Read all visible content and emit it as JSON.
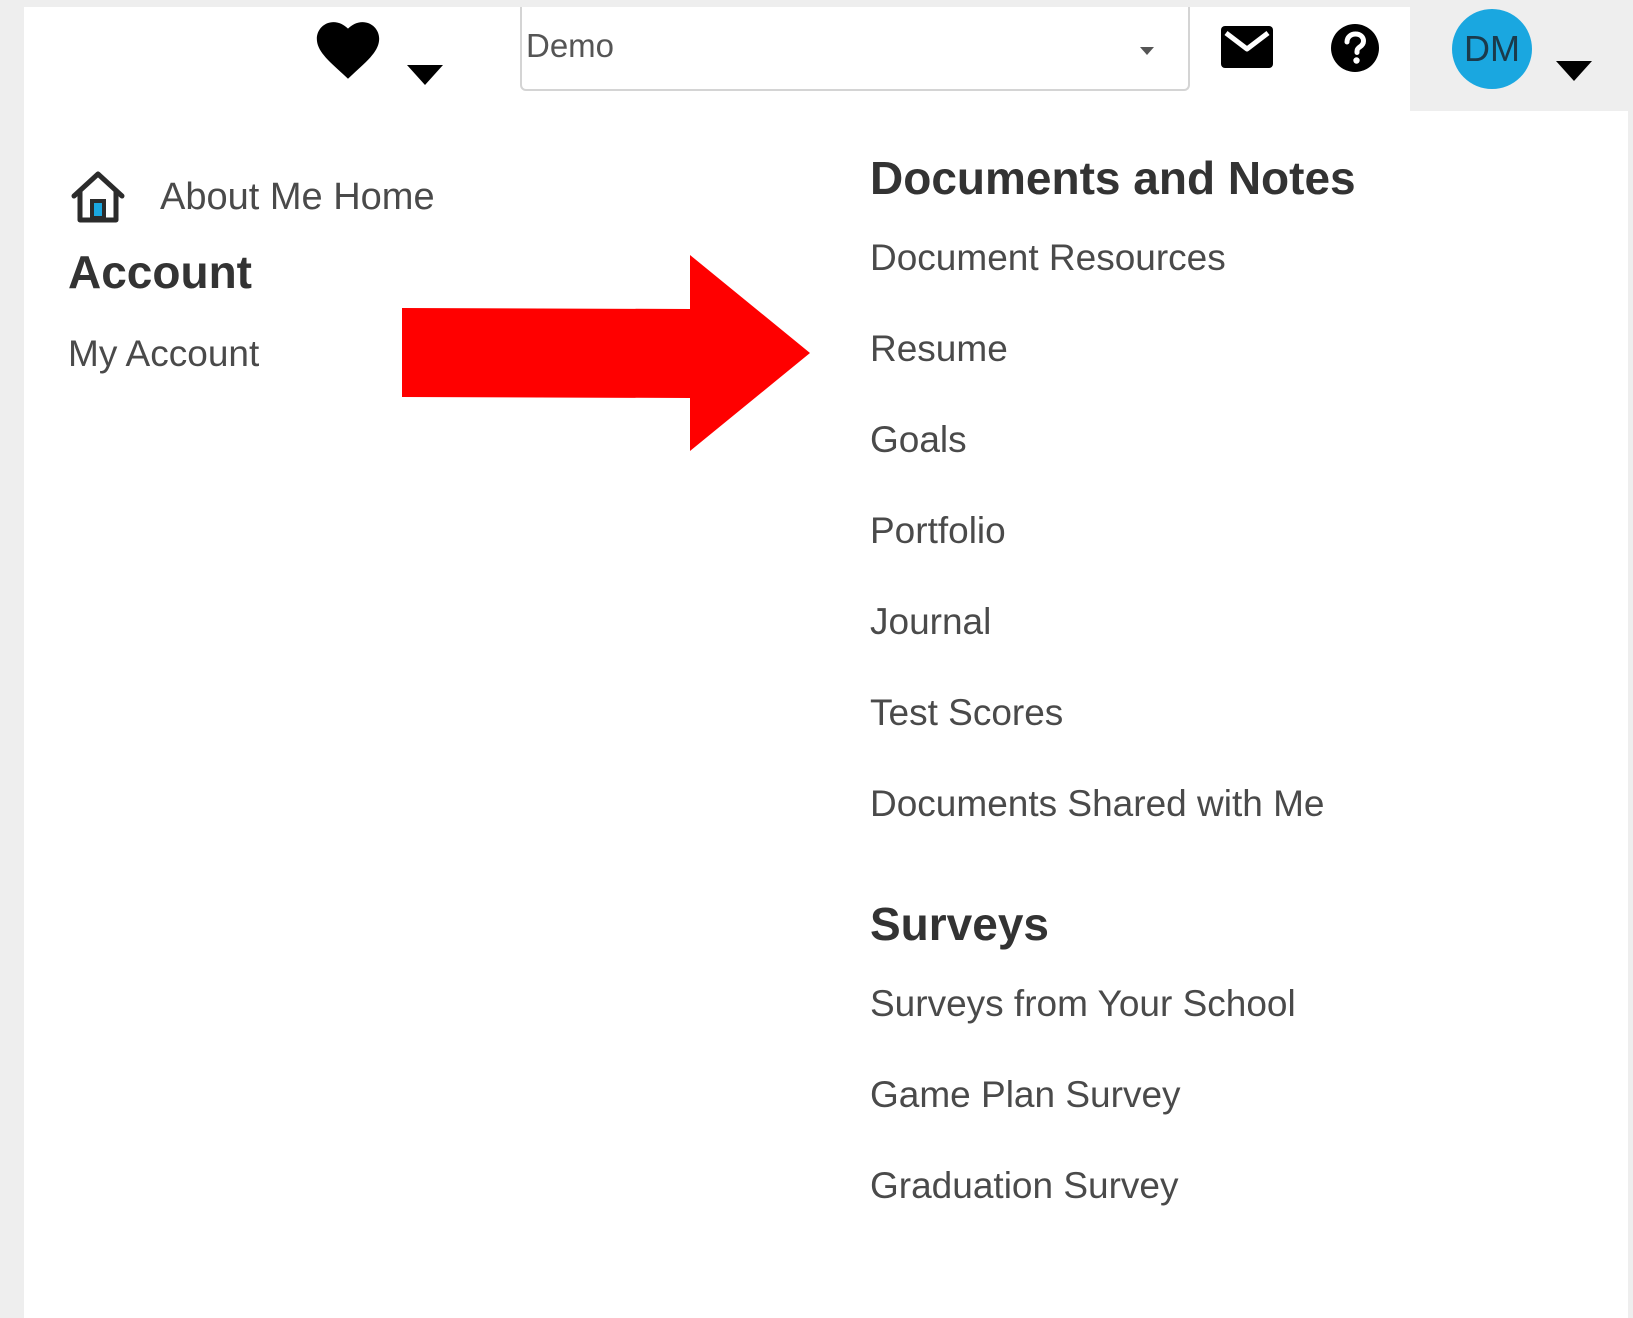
{
  "topbar": {
    "favorites_icon": "heart-icon",
    "school_select": {
      "value": "Demo"
    },
    "mail_icon": "envelope-icon",
    "help_icon": "question-circle-icon",
    "user": {
      "initials": "DM",
      "avatar_color": "#1aa7e0"
    }
  },
  "left_menu": {
    "home": {
      "icon": "house-icon",
      "label": "About Me Home"
    },
    "account": {
      "heading": "Account",
      "items": [
        {
          "label": "My Account"
        }
      ]
    }
  },
  "right_menu": {
    "documents": {
      "heading": "Documents and Notes",
      "items": [
        {
          "label": "Document Resources"
        },
        {
          "label": "Resume"
        },
        {
          "label": "Goals"
        },
        {
          "label": "Portfolio"
        },
        {
          "label": "Journal"
        },
        {
          "label": "Test Scores"
        },
        {
          "label": "Documents Shared with Me"
        }
      ]
    },
    "surveys": {
      "heading": "Surveys",
      "items": [
        {
          "label": "Surveys from Your School"
        },
        {
          "label": "Game Plan Survey"
        },
        {
          "label": "Graduation Survey"
        }
      ]
    }
  },
  "annotation": {
    "arrow_color": "#ff0000"
  }
}
